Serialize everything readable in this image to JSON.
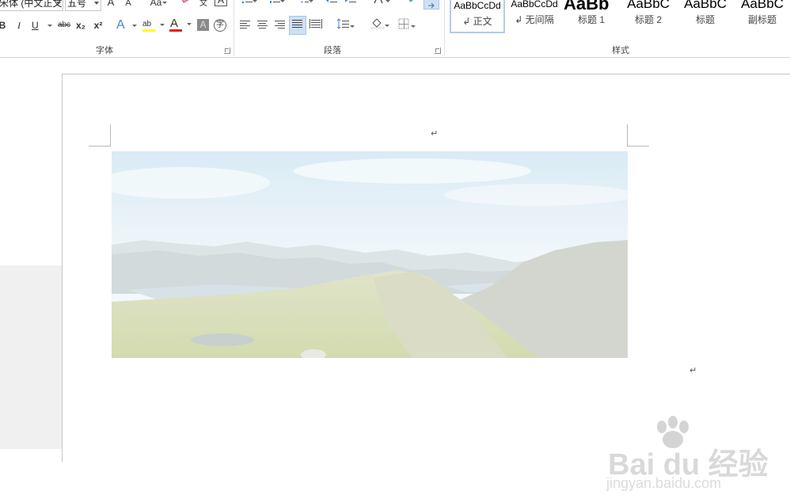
{
  "font_group": {
    "font_name": "宋体 (中文正文)",
    "font_size": "五号",
    "grow_label": "A",
    "shrink_label": "A",
    "case_label": "Aa",
    "phonetic_label": "文",
    "border_char_label": "A",
    "bold": "B",
    "italic": "I",
    "underline": "U",
    "strike": "abc",
    "subscript": "x₂",
    "superscript": "x²",
    "text_effect": "A",
    "highlight": "ab",
    "font_color": "A",
    "char_shade": "A",
    "enclose": "字",
    "label": "字体",
    "font_color_bar": "#e02020",
    "highlight_bar": "#ffff00"
  },
  "paragraph_group": {
    "label": "段落"
  },
  "styles_group": {
    "label": "样式",
    "items": [
      {
        "sample": "AaBbCcDd",
        "name": "↲ 正文"
      },
      {
        "sample": "AaBbCcDd",
        "name": "↲ 无间隔"
      },
      {
        "sample": "AaBb",
        "name": "标题 1"
      },
      {
        "sample": "AaBbC",
        "name": "标题 2"
      },
      {
        "sample": "AaBbC",
        "name": "标题"
      },
      {
        "sample": "AaBbC",
        "name": "副标题"
      }
    ]
  },
  "document": {
    "paragraph_mark": "↵",
    "image_after_mark": "↵"
  },
  "watermark": {
    "logo": "Bai du 经验",
    "url": "jingyan.baidu.com"
  }
}
